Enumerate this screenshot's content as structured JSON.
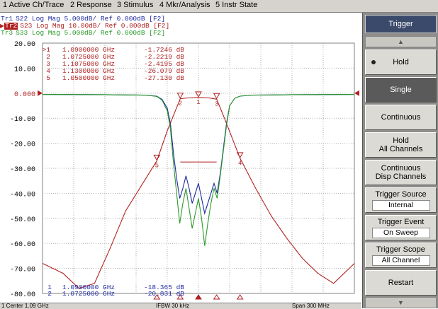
{
  "menu": [
    "1 Active Ch/Trace",
    "2 Response",
    "3 Stimulus",
    "4 Mkr/Analysis",
    "5 Instr State"
  ],
  "traces": [
    {
      "id": "Tr1",
      "text": "S22 Log Mag 5.000dB/ Ref 0.000dB [F2]",
      "color": "#1e2aa0",
      "active": false
    },
    {
      "id": "Tr2",
      "text": "S23 Log Mag 10.00dB/ Ref 0.000dB [F2]",
      "color": "#b02020",
      "active": true
    },
    {
      "id": "Tr3",
      "text": "S33 Log Mag 5.000dB/ Ref 0.000dB [F2]",
      "color": "#2a9a2a",
      "active": false
    }
  ],
  "marker_table_top": [
    {
      "label": ">1",
      "freq": "1.0900000 GHz",
      "value": "-1.7246 dB"
    },
    {
      "label": "2",
      "freq": "1.0725000 GHz",
      "value": "-2.2219 dB"
    },
    {
      "label": "3",
      "freq": "1.1075000 GHz",
      "value": "-2.4195 dB"
    },
    {
      "label": "4",
      "freq": "1.1300000 GHz",
      "value": "-26.079 dB"
    },
    {
      "label": "5",
      "freq": "1.0500000 GHz",
      "value": "-27.130 dB"
    }
  ],
  "marker_table_bottom": [
    {
      "label": "1",
      "freq": "1.0900000 GHz",
      "value": "-18.365 dB"
    },
    {
      "label": "2",
      "freq": "1.0725000 GHz",
      "value": "-20.831 dB"
    }
  ],
  "ref_value": "0.000",
  "softkeys": {
    "title": "Trigger",
    "scroll_up": "▲",
    "scroll_down": "▼",
    "hold": "Hold",
    "single": "Single",
    "continuous": "Continuous",
    "hold_all_1": "Hold",
    "hold_all_2": "All Channels",
    "cont_disp_1": "Continuous",
    "cont_disp_2": "Disp Channels",
    "trigger_source": "Trigger Source",
    "trigger_source_value": "Internal",
    "trigger_event": "Trigger Event",
    "trigger_event_value": "On Sweep",
    "trigger_scope": "Trigger Scope",
    "trigger_scope_value": "All Channel",
    "restart": "Restart"
  },
  "status": {
    "start": "1  Center 1.09 GHz",
    "ifbw": "IFBW 30 kHz",
    "span": "Span 300 MHz"
  },
  "chart_data": {
    "type": "line",
    "x_range_ghz": [
      0.94,
      1.24
    ],
    "ylim": [
      -80,
      20
    ],
    "yticks": [
      "20.00",
      "10.00",
      "0.000",
      "-10.00",
      "-20.00",
      "-30.00",
      "-40.00",
      "-50.00",
      "-60.00",
      "-70.00",
      "-80.00"
    ],
    "series": [
      {
        "name": "S22",
        "color": "#1e2aa0",
        "x": [
          0.94,
          1.0,
          1.04,
          1.05,
          1.055,
          1.06,
          1.063,
          1.066,
          1.069,
          1.072,
          1.075,
          1.078,
          1.081,
          1.084,
          1.087,
          1.09,
          1.093,
          1.096,
          1.099,
          1.102,
          1.105,
          1.108,
          1.111,
          1.114,
          1.117,
          1.12,
          1.125,
          1.13,
          1.14,
          1.18,
          1.24
        ],
        "y": [
          -0.5,
          -0.6,
          -0.8,
          -1.2,
          -2.5,
          -6,
          -12,
          -24,
          -34,
          -42,
          -38,
          -33,
          -38,
          -44,
          -40,
          -36,
          -42,
          -48,
          -44,
          -40,
          -36,
          -40,
          -32,
          -22,
          -12,
          -5,
          -2,
          -1.2,
          -0.8,
          -0.6,
          -0.5
        ]
      },
      {
        "name": "S23",
        "color": "#b02020",
        "x": [
          0.94,
          0.96,
          0.975,
          0.99,
          1.005,
          1.02,
          1.035,
          1.05,
          1.06,
          1.0725,
          1.08,
          1.09,
          1.1,
          1.1075,
          1.115,
          1.13,
          1.145,
          1.16,
          1.175,
          1.19,
          1.205,
          1.22,
          1.235,
          1.24
        ],
        "y": [
          -68,
          -72,
          -78,
          -76,
          -62,
          -47,
          -37,
          -27,
          -15,
          -2.2,
          -1.9,
          -1.7,
          -1.9,
          -2.4,
          -10,
          -26,
          -38,
          -49,
          -58,
          -66,
          -72,
          -76,
          -70,
          -68
        ]
      },
      {
        "name": "S33",
        "color": "#2a9a2a",
        "x": [
          0.94,
          1.0,
          1.04,
          1.05,
          1.055,
          1.06,
          1.063,
          1.066,
          1.069,
          1.072,
          1.075,
          1.078,
          1.081,
          1.084,
          1.087,
          1.09,
          1.093,
          1.096,
          1.099,
          1.102,
          1.105,
          1.108,
          1.111,
          1.114,
          1.117,
          1.12,
          1.125,
          1.13,
          1.14,
          1.18,
          1.24
        ],
        "y": [
          -0.5,
          -0.6,
          -0.8,
          -1.3,
          -2.8,
          -7,
          -14,
          -28,
          -40,
          -52,
          -44,
          -38,
          -46,
          -54,
          -48,
          -42,
          -50,
          -61,
          -52,
          -44,
          -38,
          -42,
          -33,
          -23,
          -13,
          -5,
          -2,
          -1.2,
          -0.8,
          -0.6,
          -0.5
        ]
      }
    ],
    "markers": [
      {
        "label": "1",
        "x": 1.09,
        "trace": "S23"
      },
      {
        "label": "2",
        "x": 1.0725,
        "trace": "S23"
      },
      {
        "label": "3",
        "x": 1.1075,
        "trace": "S23"
      },
      {
        "label": "4",
        "x": 1.13,
        "trace": "S23"
      },
      {
        "label": "5",
        "x": 1.05,
        "trace": "S23"
      }
    ]
  }
}
